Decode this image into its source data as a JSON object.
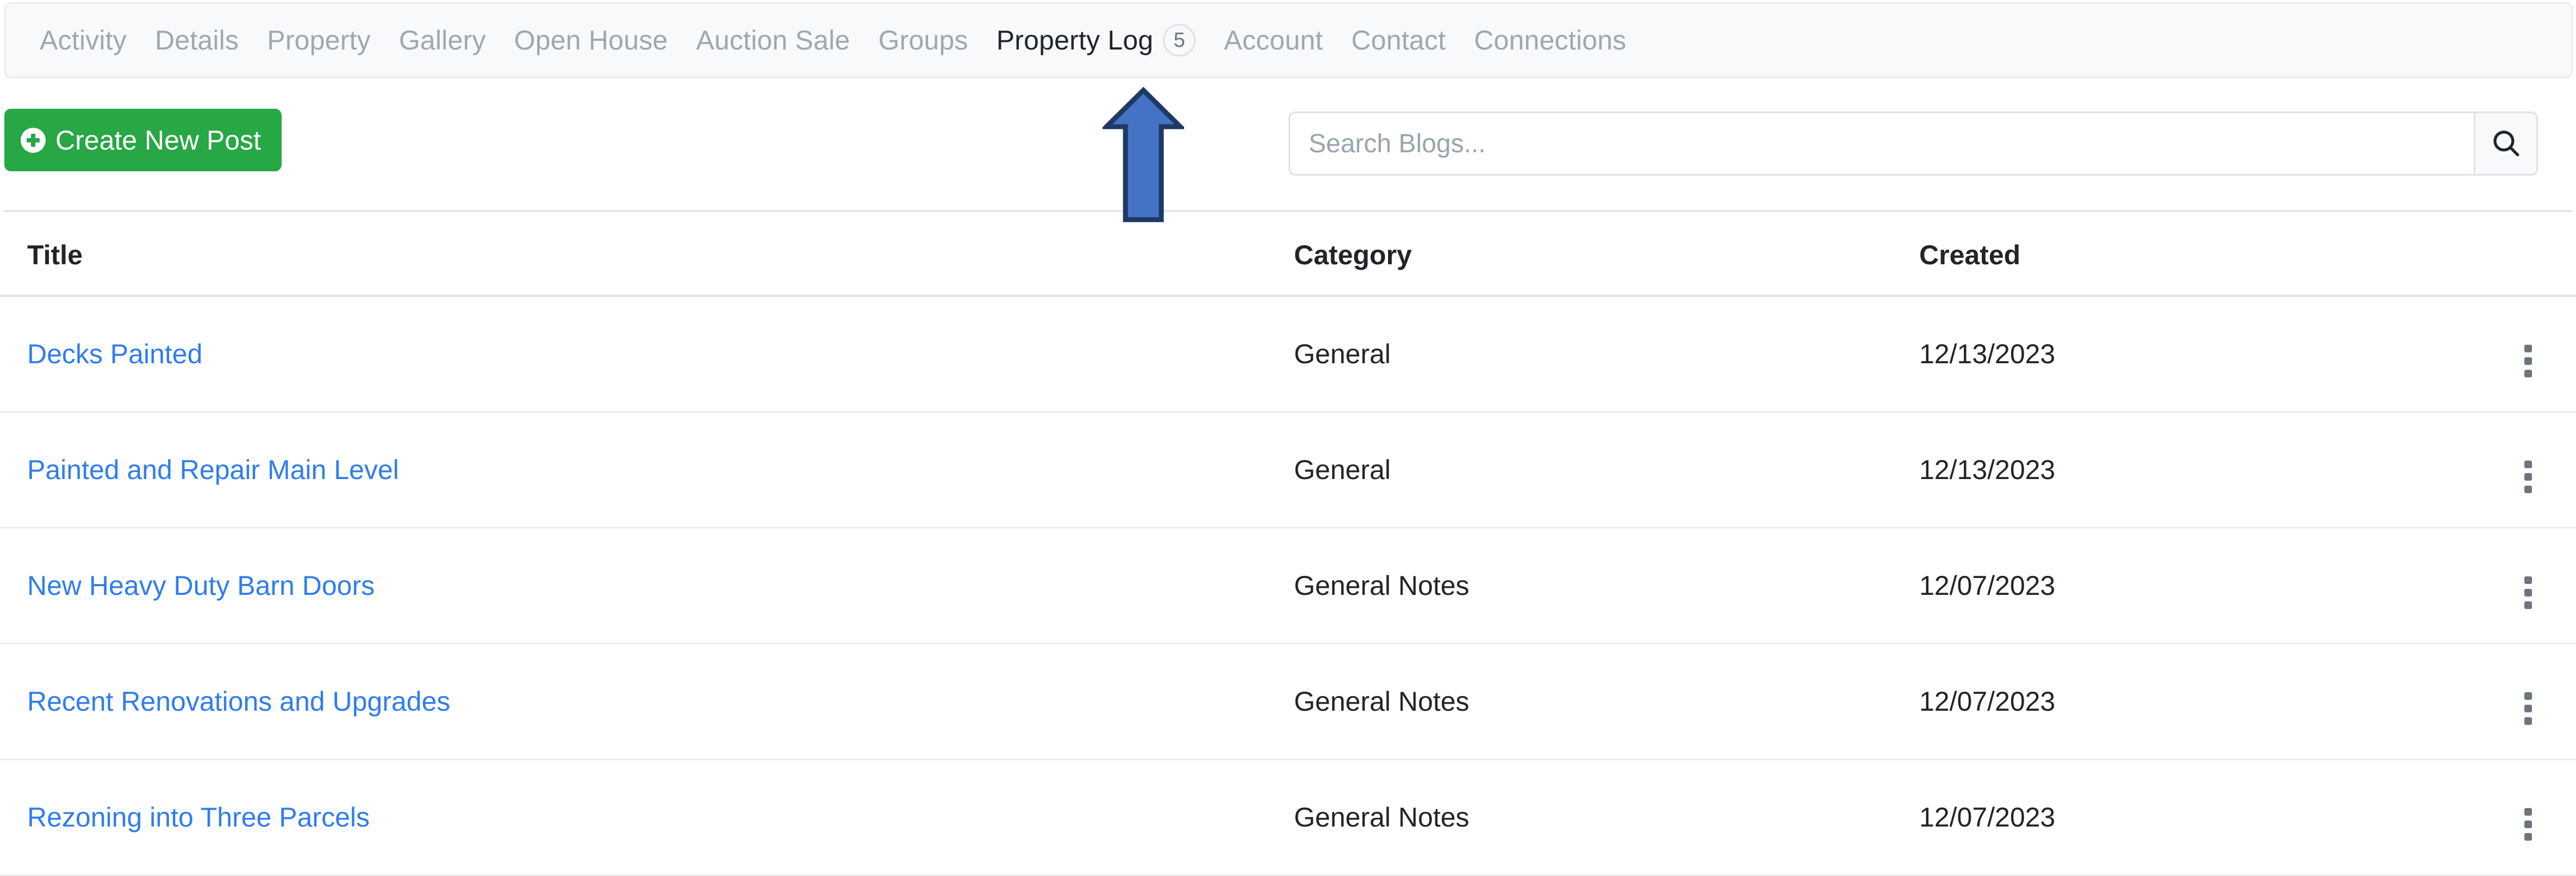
{
  "nav": {
    "items": [
      {
        "label": "Activity",
        "active": false
      },
      {
        "label": "Details",
        "active": false
      },
      {
        "label": "Property",
        "active": false
      },
      {
        "label": "Gallery",
        "active": false
      },
      {
        "label": "Open House",
        "active": false
      },
      {
        "label": "Auction Sale",
        "active": false
      },
      {
        "label": "Groups",
        "active": false
      },
      {
        "label": "Property Log",
        "active": true,
        "badge": "5"
      },
      {
        "label": "Account",
        "active": false
      },
      {
        "label": "Contact",
        "active": false
      },
      {
        "label": "Connections",
        "active": false
      }
    ],
    "active_label": "Property Log",
    "active_badge": "5"
  },
  "toolbar": {
    "create_label": "Create New Post",
    "create_icon": "plus-circle-icon",
    "create_color": "#28a745",
    "search_placeholder": "Search Blogs...",
    "search_value": "",
    "search_icon": "search-icon"
  },
  "table": {
    "columns": [
      "Title",
      "Category",
      "Created"
    ],
    "rows": [
      {
        "title": "Decks Painted",
        "category": "General",
        "created": "12/13/2023",
        "menu_icon": "kebab-menu-icon"
      },
      {
        "title": "Painted and Repair Main Level",
        "category": "General",
        "created": "12/13/2023",
        "menu_icon": "kebab-menu-icon"
      },
      {
        "title": "New Heavy Duty Barn Doors",
        "category": "General Notes",
        "created": "12/07/2023",
        "menu_icon": "kebab-menu-icon"
      },
      {
        "title": "Recent Renovations and Upgrades",
        "category": "General Notes",
        "created": "12/07/2023",
        "menu_icon": "kebab-menu-icon"
      },
      {
        "title": "Rezoning into Three Parcels",
        "category": "General Notes",
        "created": "12/07/2023",
        "menu_icon": "kebab-menu-icon"
      }
    ],
    "link_color": "#2f7ded"
  },
  "annotation": {
    "arrow_icon": "up-arrow-annotation",
    "points_at": "Property Log",
    "fill_color": "#4472C4",
    "stroke_color": "#1F3864"
  }
}
